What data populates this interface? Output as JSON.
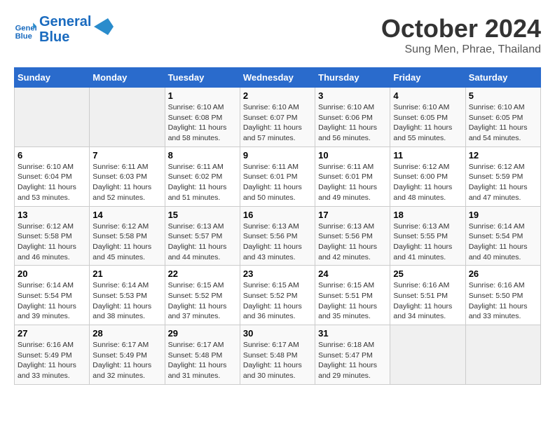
{
  "header": {
    "logo_line1": "General",
    "logo_line2": "Blue",
    "month": "October 2024",
    "location": "Sung Men, Phrae, Thailand"
  },
  "weekdays": [
    "Sunday",
    "Monday",
    "Tuesday",
    "Wednesday",
    "Thursday",
    "Friday",
    "Saturday"
  ],
  "weeks": [
    [
      {
        "day": "",
        "empty": true
      },
      {
        "day": "",
        "empty": true
      },
      {
        "day": "1",
        "sunrise": "6:10 AM",
        "sunset": "6:08 PM",
        "daylight": "11 hours and 58 minutes."
      },
      {
        "day": "2",
        "sunrise": "6:10 AM",
        "sunset": "6:07 PM",
        "daylight": "11 hours and 57 minutes."
      },
      {
        "day": "3",
        "sunrise": "6:10 AM",
        "sunset": "6:06 PM",
        "daylight": "11 hours and 56 minutes."
      },
      {
        "day": "4",
        "sunrise": "6:10 AM",
        "sunset": "6:05 PM",
        "daylight": "11 hours and 55 minutes."
      },
      {
        "day": "5",
        "sunrise": "6:10 AM",
        "sunset": "6:05 PM",
        "daylight": "11 hours and 54 minutes."
      }
    ],
    [
      {
        "day": "6",
        "sunrise": "6:10 AM",
        "sunset": "6:04 PM",
        "daylight": "11 hours and 53 minutes."
      },
      {
        "day": "7",
        "sunrise": "6:11 AM",
        "sunset": "6:03 PM",
        "daylight": "11 hours and 52 minutes."
      },
      {
        "day": "8",
        "sunrise": "6:11 AM",
        "sunset": "6:02 PM",
        "daylight": "11 hours and 51 minutes."
      },
      {
        "day": "9",
        "sunrise": "6:11 AM",
        "sunset": "6:01 PM",
        "daylight": "11 hours and 50 minutes."
      },
      {
        "day": "10",
        "sunrise": "6:11 AM",
        "sunset": "6:01 PM",
        "daylight": "11 hours and 49 minutes."
      },
      {
        "day": "11",
        "sunrise": "6:12 AM",
        "sunset": "6:00 PM",
        "daylight": "11 hours and 48 minutes."
      },
      {
        "day": "12",
        "sunrise": "6:12 AM",
        "sunset": "5:59 PM",
        "daylight": "11 hours and 47 minutes."
      }
    ],
    [
      {
        "day": "13",
        "sunrise": "6:12 AM",
        "sunset": "5:58 PM",
        "daylight": "11 hours and 46 minutes."
      },
      {
        "day": "14",
        "sunrise": "6:12 AM",
        "sunset": "5:58 PM",
        "daylight": "11 hours and 45 minutes."
      },
      {
        "day": "15",
        "sunrise": "6:13 AM",
        "sunset": "5:57 PM",
        "daylight": "11 hours and 44 minutes."
      },
      {
        "day": "16",
        "sunrise": "6:13 AM",
        "sunset": "5:56 PM",
        "daylight": "11 hours and 43 minutes."
      },
      {
        "day": "17",
        "sunrise": "6:13 AM",
        "sunset": "5:56 PM",
        "daylight": "11 hours and 42 minutes."
      },
      {
        "day": "18",
        "sunrise": "6:13 AM",
        "sunset": "5:55 PM",
        "daylight": "11 hours and 41 minutes."
      },
      {
        "day": "19",
        "sunrise": "6:14 AM",
        "sunset": "5:54 PM",
        "daylight": "11 hours and 40 minutes."
      }
    ],
    [
      {
        "day": "20",
        "sunrise": "6:14 AM",
        "sunset": "5:54 PM",
        "daylight": "11 hours and 39 minutes."
      },
      {
        "day": "21",
        "sunrise": "6:14 AM",
        "sunset": "5:53 PM",
        "daylight": "11 hours and 38 minutes."
      },
      {
        "day": "22",
        "sunrise": "6:15 AM",
        "sunset": "5:52 PM",
        "daylight": "11 hours and 37 minutes."
      },
      {
        "day": "23",
        "sunrise": "6:15 AM",
        "sunset": "5:52 PM",
        "daylight": "11 hours and 36 minutes."
      },
      {
        "day": "24",
        "sunrise": "6:15 AM",
        "sunset": "5:51 PM",
        "daylight": "11 hours and 35 minutes."
      },
      {
        "day": "25",
        "sunrise": "6:16 AM",
        "sunset": "5:51 PM",
        "daylight": "11 hours and 34 minutes."
      },
      {
        "day": "26",
        "sunrise": "6:16 AM",
        "sunset": "5:50 PM",
        "daylight": "11 hours and 33 minutes."
      }
    ],
    [
      {
        "day": "27",
        "sunrise": "6:16 AM",
        "sunset": "5:49 PM",
        "daylight": "11 hours and 33 minutes."
      },
      {
        "day": "28",
        "sunrise": "6:17 AM",
        "sunset": "5:49 PM",
        "daylight": "11 hours and 32 minutes."
      },
      {
        "day": "29",
        "sunrise": "6:17 AM",
        "sunset": "5:48 PM",
        "daylight": "11 hours and 31 minutes."
      },
      {
        "day": "30",
        "sunrise": "6:17 AM",
        "sunset": "5:48 PM",
        "daylight": "11 hours and 30 minutes."
      },
      {
        "day": "31",
        "sunrise": "6:18 AM",
        "sunset": "5:47 PM",
        "daylight": "11 hours and 29 minutes."
      },
      {
        "day": "",
        "empty": true
      },
      {
        "day": "",
        "empty": true
      }
    ]
  ]
}
